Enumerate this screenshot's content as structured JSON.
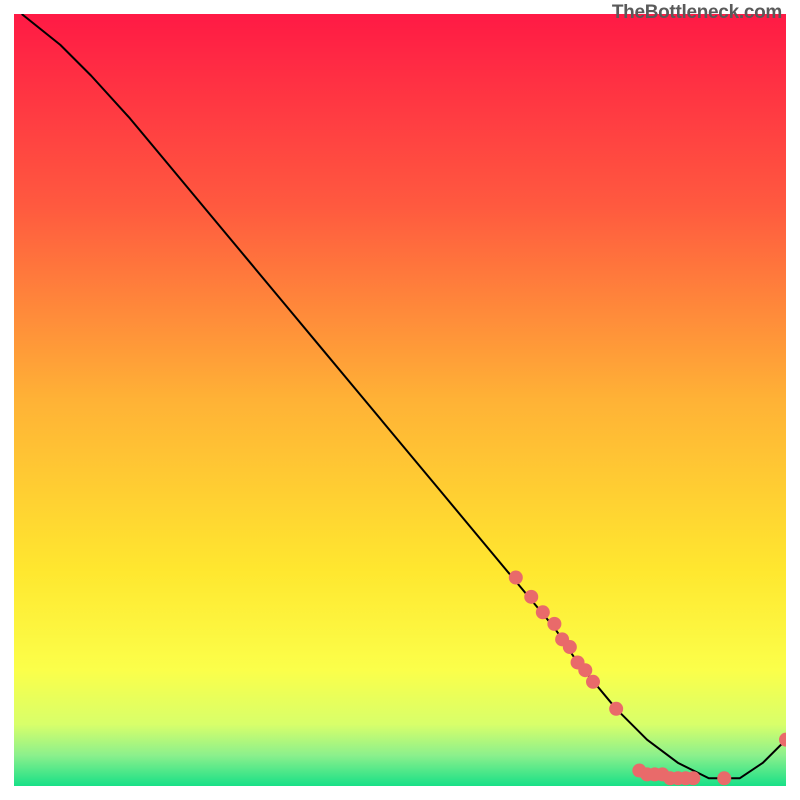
{
  "watermark": "TheBottleneck.com",
  "chart_data": {
    "type": "line",
    "title": "",
    "xlabel": "",
    "ylabel": "",
    "xlim": [
      0,
      100
    ],
    "ylim": [
      0,
      100
    ],
    "grid": false,
    "legend": false,
    "series": [
      {
        "name": "bottleneck-curve",
        "type": "line",
        "color": "#000000",
        "x": [
          1,
          6,
          10,
          15,
          20,
          25,
          30,
          35,
          40,
          45,
          50,
          55,
          60,
          65,
          70,
          73,
          78,
          82,
          86,
          90,
          94,
          97,
          100
        ],
        "y": [
          100,
          96,
          92,
          86.5,
          80.5,
          74.5,
          68.5,
          62.5,
          56.5,
          50.5,
          44.5,
          38.5,
          32.5,
          26.5,
          20.5,
          16,
          10,
          6,
          3,
          1,
          1,
          3,
          6
        ]
      },
      {
        "name": "markers",
        "type": "scatter",
        "color": "#e96a6a",
        "x": [
          65,
          67,
          68.5,
          70,
          71,
          72,
          73,
          74,
          75,
          78,
          81,
          82,
          83,
          84,
          85,
          86,
          87,
          88,
          92,
          100
        ],
        "y": [
          27,
          24.5,
          22.5,
          21,
          19,
          18,
          16,
          15,
          13.5,
          10,
          2,
          1.5,
          1.5,
          1.5,
          1,
          1,
          1,
          1,
          1,
          6
        ]
      }
    ],
    "background": {
      "type": "vertical-gradient",
      "stops": [
        {
          "pos": 0.0,
          "color": "#ff1a45"
        },
        {
          "pos": 0.25,
          "color": "#ff5a3f"
        },
        {
          "pos": 0.5,
          "color": "#ffb236"
        },
        {
          "pos": 0.72,
          "color": "#ffe72f"
        },
        {
          "pos": 0.85,
          "color": "#fbff4a"
        },
        {
          "pos": 0.92,
          "color": "#d8ff6a"
        },
        {
          "pos": 0.96,
          "color": "#8cf08c"
        },
        {
          "pos": 1.0,
          "color": "#18e087"
        }
      ]
    }
  }
}
